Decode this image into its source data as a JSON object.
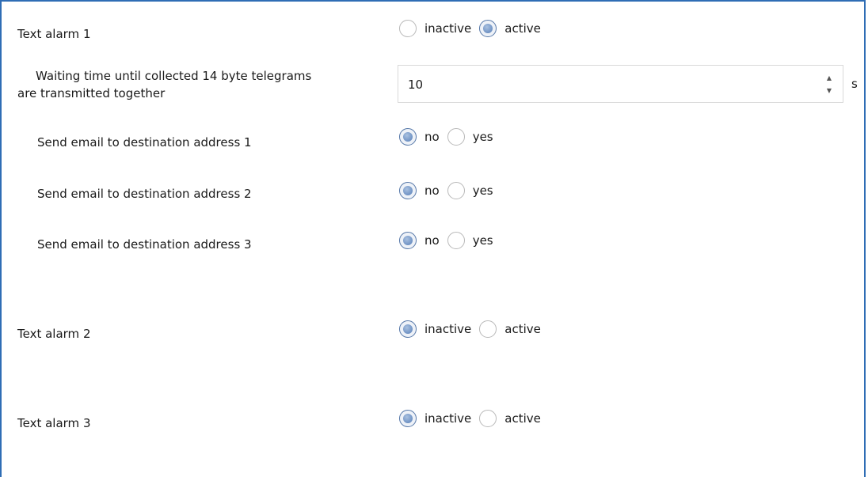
{
  "text_alarm_1": {
    "label": "Text alarm 1",
    "options": [
      "inactive",
      "active"
    ],
    "selected": "active"
  },
  "waiting_time": {
    "label_line1": "Waiting time until collected 14 byte telegrams",
    "label_line2": "are transmitted together",
    "value": "10",
    "unit": "s",
    "up_icon": "▲",
    "down_icon": "▼"
  },
  "email_1": {
    "label": "Send email to destination address 1",
    "options": [
      "no",
      "yes"
    ],
    "selected": "no"
  },
  "email_2": {
    "label": "Send email to destination address 2",
    "options": [
      "no",
      "yes"
    ],
    "selected": "no"
  },
  "email_3": {
    "label": "Send email to destination address 3",
    "options": [
      "no",
      "yes"
    ],
    "selected": "no"
  },
  "text_alarm_2": {
    "label": "Text alarm 2",
    "options": [
      "inactive",
      "active"
    ],
    "selected": "inactive"
  },
  "text_alarm_3": {
    "label": "Text alarm 3",
    "options": [
      "inactive",
      "active"
    ],
    "selected": "inactive"
  },
  "colors": {
    "frame_border": "#2f6db5",
    "radio_checked": "#6f92c4"
  }
}
